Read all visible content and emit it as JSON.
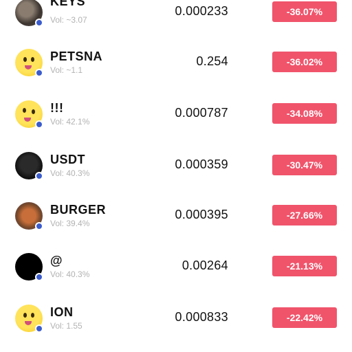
{
  "colors": {
    "change_negative": "#f0546b"
  },
  "tokens": [
    {
      "symbol": "KEYS",
      "volume": "Vol: ~3.07",
      "price": "0.000233",
      "change": "-36.07%",
      "avatar_icon": "keys-token-icon",
      "badge_icon": "chain-badge-icon"
    },
    {
      "symbol": "PETSNA",
      "volume": "Vol: ~1.1",
      "price": "0.254",
      "change": "-36.02%",
      "avatar_icon": "face-emoji-token-icon",
      "badge_icon": "chain-badge-icon"
    },
    {
      "symbol": "!!!",
      "volume": "Vol: 42.1%",
      "price": "0.000787",
      "change": "-34.08%",
      "avatar_icon": "face-emoji-token-icon",
      "badge_icon": "chain-badge-icon"
    },
    {
      "symbol": "USDT",
      "volume": "Vol: 40.3%",
      "price": "0.000359",
      "change": "-30.47%",
      "avatar_icon": "usdt-token-icon",
      "badge_icon": "chain-badge-icon"
    },
    {
      "symbol": "BURGER",
      "volume": "Vol: 39.4%",
      "price": "0.000395",
      "change": "-27.66%",
      "avatar_icon": "burger-token-icon",
      "badge_icon": "chain-badge-icon"
    },
    {
      "symbol": "@",
      "volume": "Vol: 40.3%",
      "price": "0.00264",
      "change": "-21.13%",
      "avatar_icon": "at-token-icon",
      "badge_icon": "chain-badge-icon"
    },
    {
      "symbol": "ION",
      "volume": "Vol: 1.55",
      "price": "0.000833",
      "change": "-22.42%",
      "avatar_icon": "face-emoji-token-icon",
      "badge_icon": "chain-badge-icon"
    }
  ]
}
